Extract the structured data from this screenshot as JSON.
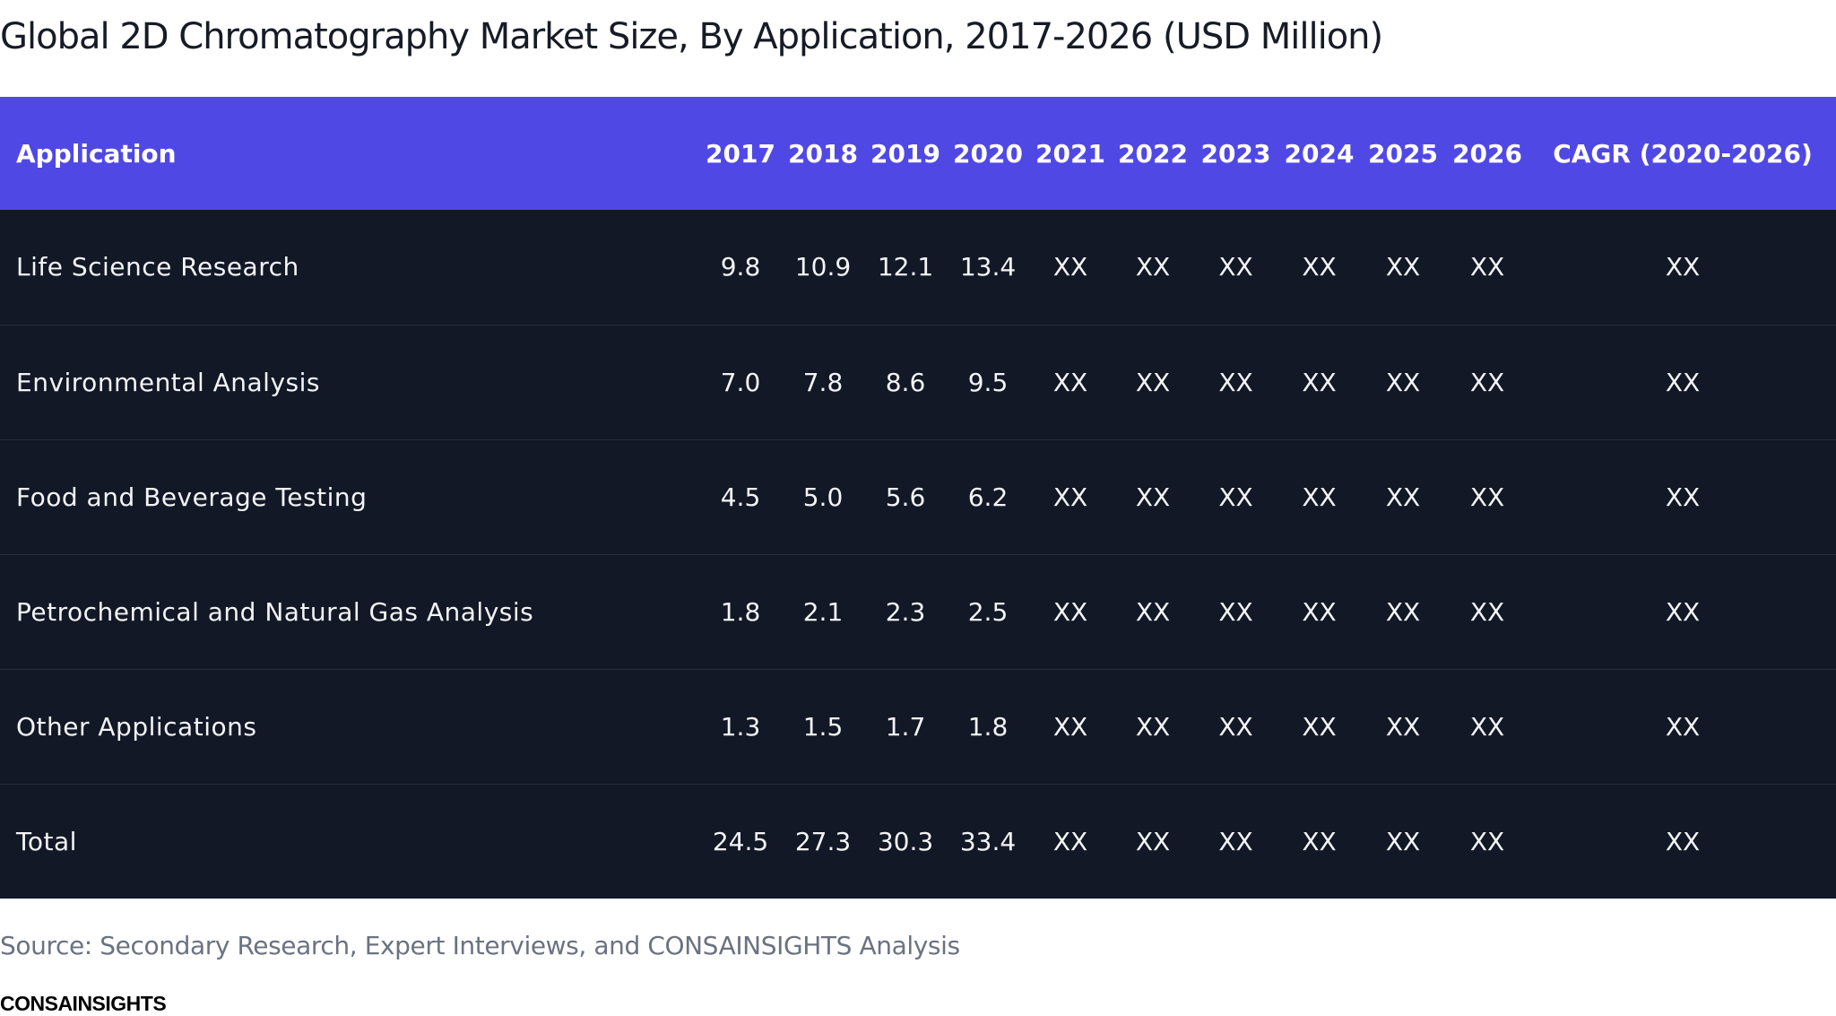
{
  "title": "Global 2D Chromatography Market Size, By Application, 2017-2026 (USD Million)",
  "source": "Source: Secondary Research, Expert Interviews, and CONSAINSIGHTS Analysis",
  "brand": "CONSAINSIGHTS",
  "colors": {
    "header_bg": "#5048e5",
    "body_bg": "#121826",
    "header_text": "#ffffff",
    "body_text": "#f3f4f6",
    "source_text": "#6b7280"
  },
  "chart_data": {
    "type": "table",
    "title": "Global 2D Chromatography Market Size, By Application, 2017-2026 (USD Million)",
    "columns": [
      "Application",
      "2017",
      "2018",
      "2019",
      "2020",
      "2021",
      "2022",
      "2023",
      "2024",
      "2025",
      "2026",
      "CAGR (2020-2026)"
    ],
    "rows": [
      [
        "Life Science Research",
        "9.8",
        "10.9",
        "12.1",
        "13.4",
        "XX",
        "XX",
        "XX",
        "XX",
        "XX",
        "XX",
        "XX"
      ],
      [
        "Environmental Analysis",
        "7.0",
        "7.8",
        "8.6",
        "9.5",
        "XX",
        "XX",
        "XX",
        "XX",
        "XX",
        "XX",
        "XX"
      ],
      [
        "Food and Beverage Testing",
        "4.5",
        "5.0",
        "5.6",
        "6.2",
        "XX",
        "XX",
        "XX",
        "XX",
        "XX",
        "XX",
        "XX"
      ],
      [
        "Petrochemical and Natural Gas Analysis",
        "1.8",
        "2.1",
        "2.3",
        "2.5",
        "XX",
        "XX",
        "XX",
        "XX",
        "XX",
        "XX",
        "XX"
      ],
      [
        "Other Applications",
        "1.3",
        "1.5",
        "1.7",
        "1.8",
        "XX",
        "XX",
        "XX",
        "XX",
        "XX",
        "XX",
        "XX"
      ],
      [
        "Total",
        "24.5",
        "27.3",
        "30.3",
        "33.4",
        "XX",
        "XX",
        "XX",
        "XX",
        "XX",
        "XX",
        "XX"
      ]
    ]
  }
}
